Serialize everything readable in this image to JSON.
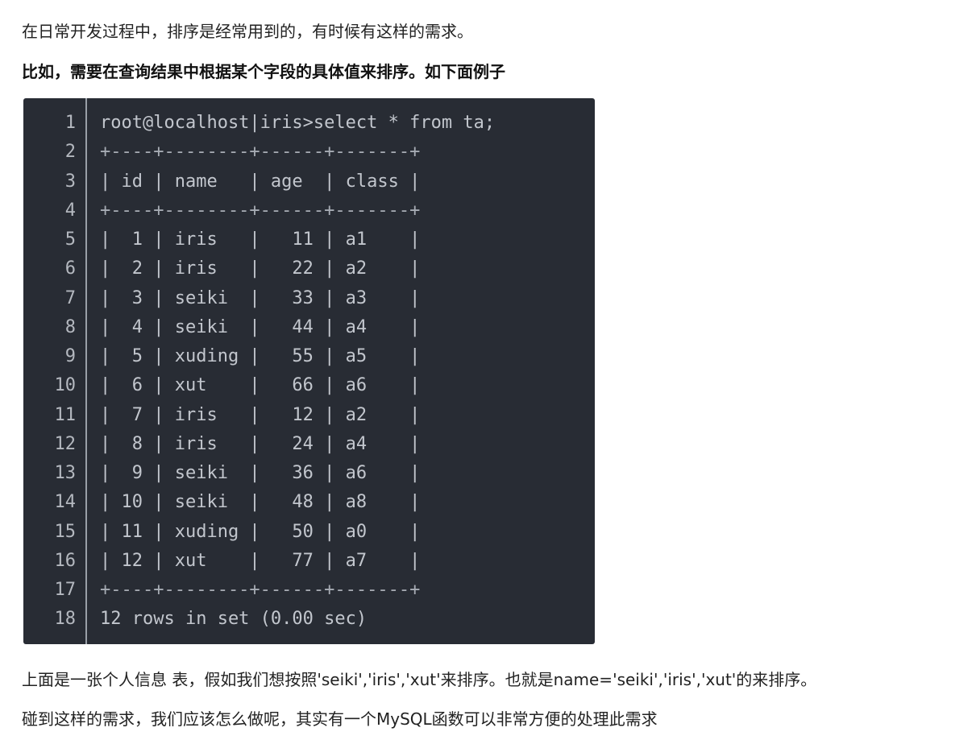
{
  "article": {
    "intro": "在日常开发过程中，排序是经常用到的，有时候有这样的需求。",
    "example_heading": "比如，需要在查询结果中根据某个字段的具体值来排序。如下面例子",
    "description": "上面是一张个人信息 表，假如我们想按照'seiki','iris','xut'来排序。也就是name='seiki','iris','xut'的来排序。",
    "question": "碰到这样的需求，我们应该怎么做呢，其实有一个MySQL函数可以非常方便的处理此需求"
  },
  "code_block": {
    "language": "sql-console",
    "background_color": "#282c34",
    "lines": [
      "root@localhost|iris>select * from ta;",
      "+----+--------+------+-------+",
      "| id | name   | age  | class |",
      "+----+--------+------+-------+",
      "|  1 | iris   |   11 | a1    |",
      "|  2 | iris   |   22 | a2    |",
      "|  3 | seiki  |   33 | a3    |",
      "|  4 | seiki  |   44 | a4    |",
      "|  5 | xuding |   55 | a5    |",
      "|  6 | xut    |   66 | a6    |",
      "|  7 | iris   |   12 | a2    |",
      "|  8 | iris   |   24 | a4    |",
      "|  9 | seiki  |   36 | a6    |",
      "| 10 | seiki  |   48 | a8    |",
      "| 11 | xuding |   50 | a0    |",
      "| 12 | xut    |   77 | a7    |",
      "+----+--------+------+-------+",
      "12 rows in set (0.00 sec)"
    ],
    "line_numbers": [
      "1",
      "2",
      "3",
      "4",
      "5",
      "6",
      "7",
      "8",
      "9",
      "10",
      "11",
      "12",
      "13",
      "14",
      "15",
      "16",
      "17",
      "18"
    ]
  }
}
